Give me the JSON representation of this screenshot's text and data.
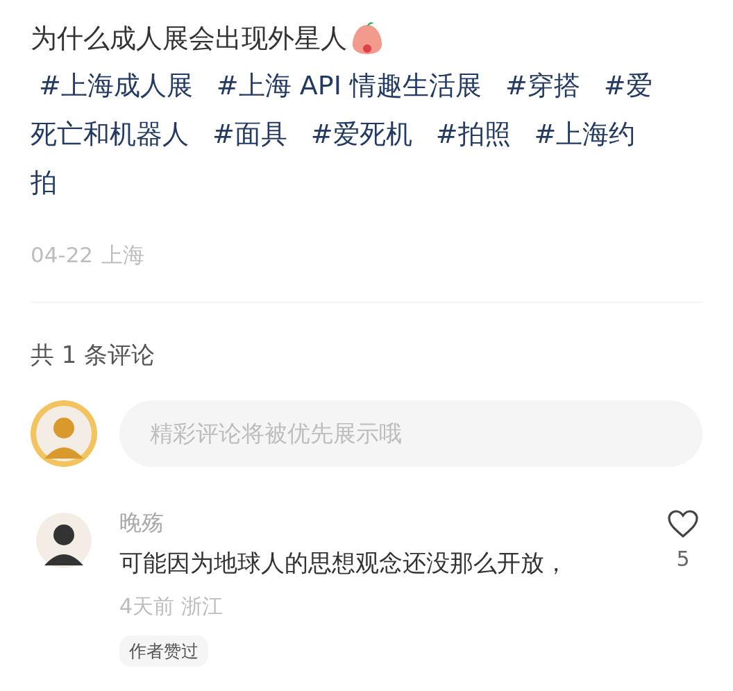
{
  "post": {
    "title": "为什么成人展会出现外星人",
    "tag_lines": [
      [
        "#上海成人展",
        "#上海 API 情趣生活展",
        "#穿搭",
        "#爱"
      ],
      [
        "死亡和机器人",
        "#面具",
        "#爱死机",
        "#拍照",
        "#上海约"
      ],
      [
        "拍"
      ]
    ],
    "date": "04-22",
    "location": "上海"
  },
  "comments_header": "共 1 条评论",
  "comment_input": {
    "placeholder": "精彩评论将被优先展示哦"
  },
  "comments": [
    {
      "user": "晚殇",
      "text": "可能因为地球人的思想观念还没那么开放，",
      "time": "4天前",
      "location": "浙江",
      "likes": "5",
      "liked": false,
      "badge": "作者赞过"
    }
  ]
}
